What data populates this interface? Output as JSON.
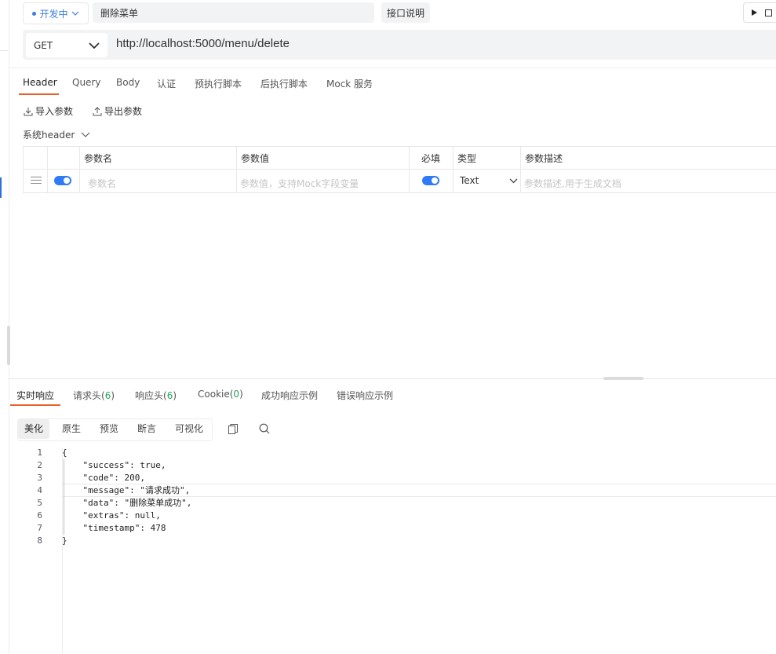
{
  "toolbar": {
    "status_label": "开发中",
    "name_value": "删除菜单",
    "doc_button": "接口说明"
  },
  "request": {
    "method": "GET",
    "url": "http://localhost:5000/menu/delete"
  },
  "tabs": [
    "Header",
    "Query",
    "Body",
    "认证",
    "预执行脚本",
    "后执行脚本",
    "Mock 服务"
  ],
  "actions": {
    "import": "导入参数",
    "export": "导出参数"
  },
  "system_header": "系统header",
  "params_table": {
    "headers": [
      "参数名",
      "参数值",
      "必填",
      "类型",
      "参数描述"
    ],
    "row": {
      "name_placeholder": "参数名",
      "value_placeholder": "参数值，支持Mock字段变量",
      "type": "Text",
      "desc_placeholder": "参数描述,用于生成文档"
    }
  },
  "response_tabs": [
    {
      "label": "实时响应",
      "count": ""
    },
    {
      "label": "请求头",
      "count": "6"
    },
    {
      "label": "响应头",
      "count": "6"
    },
    {
      "label": "Cookie",
      "count": "0"
    },
    {
      "label": "成功响应示例",
      "count": ""
    },
    {
      "label": "错误响应示例",
      "count": ""
    }
  ],
  "format_options": [
    "美化",
    "原生",
    "预览",
    "断言",
    "可视化"
  ],
  "code_lines": [
    {
      "num": "1",
      "text": "{"
    },
    {
      "num": "2",
      "text": "    \"success\": true,"
    },
    {
      "num": "3",
      "text": "    \"code\": 200,"
    },
    {
      "num": "4",
      "text": "    \"message\": \"请求成功\","
    },
    {
      "num": "5",
      "text": "    \"data\": \"删除菜单成功\","
    },
    {
      "num": "6",
      "text": "    \"extras\": null,"
    },
    {
      "num": "7",
      "text": "    \"timestamp\": 478"
    },
    {
      "num": "8",
      "text": "}"
    }
  ],
  "colors": {
    "accent": "#e8612d",
    "toggle": "#2f7bf5",
    "status": "#3b7ddd",
    "count": "#2aa45a"
  }
}
